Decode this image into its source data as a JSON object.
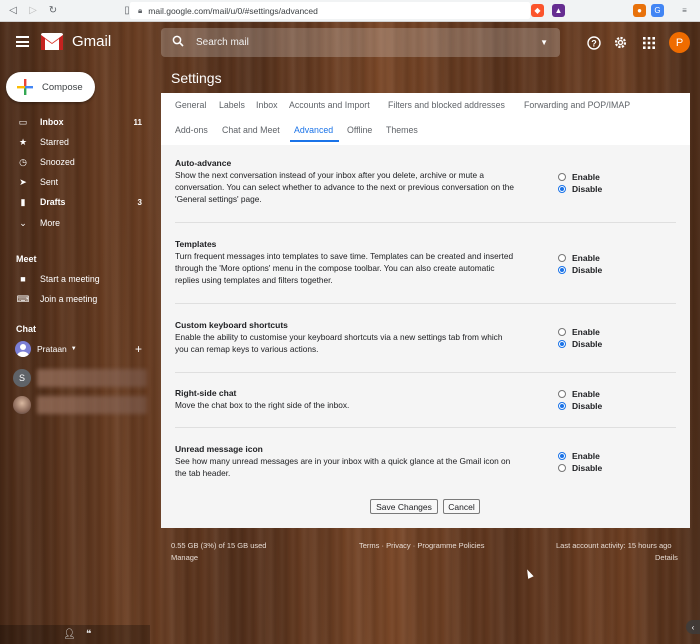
{
  "browser": {
    "url": "mail.google.com/mail/u/0/#settings/advanced"
  },
  "header": {
    "app_name": "Gmail",
    "search_placeholder": "Search mail",
    "avatar_letter": "P"
  },
  "sidebar": {
    "compose_label": "Compose",
    "items": [
      {
        "label": "Inbox",
        "count": "11",
        "icon": "inbox-icon"
      },
      {
        "label": "Starred",
        "count": "",
        "icon": "star-icon"
      },
      {
        "label": "Snoozed",
        "count": "",
        "icon": "clock-icon"
      },
      {
        "label": "Sent",
        "count": "",
        "icon": "send-icon"
      },
      {
        "label": "Drafts",
        "count": "3",
        "icon": "draft-icon"
      },
      {
        "label": "More",
        "count": "",
        "icon": "chevron-down-icon"
      }
    ],
    "meet": {
      "heading": "Meet",
      "items": [
        {
          "label": "Start a meeting",
          "icon": "video-icon"
        },
        {
          "label": "Join a meeting",
          "icon": "keyboard-icon"
        }
      ]
    },
    "chat": {
      "heading": "Chat",
      "user": "Prataan",
      "contact_initial": "S"
    }
  },
  "settings": {
    "title": "Settings",
    "tabs_row1": [
      "General",
      "Labels",
      "Inbox",
      "Accounts and Import",
      "Filters and blocked addresses",
      "Forwarding and POP/IMAP"
    ],
    "tabs_row2": [
      "Add-ons",
      "Chat and Meet",
      "Advanced",
      "Offline",
      "Themes"
    ],
    "active_tab": "Advanced",
    "items": [
      {
        "title": "Auto-advance",
        "desc": "Show the next conversation instead of your inbox after you delete, archive or mute a conversation. You can select whether to advance to the next or previous conversation on the 'General settings' page.",
        "enable_label": "Enable",
        "disable_label": "Disable",
        "selected": "Disable"
      },
      {
        "title": "Templates",
        "desc": "Turn frequent messages into templates to save time. Templates can be created and inserted through the 'More options' menu in the compose toolbar. You can also create automatic replies using templates and filters together.",
        "enable_label": "Enable",
        "disable_label": "Disable",
        "selected": "Disable"
      },
      {
        "title": "Custom keyboard shortcuts",
        "desc": "Enable the ability to customise your keyboard shortcuts via a new settings tab from which you can remap keys to various actions.",
        "enable_label": "Enable",
        "disable_label": "Disable",
        "selected": "Disable"
      },
      {
        "title": "Right-side chat",
        "desc": "Move the chat box to the right side of the inbox.",
        "enable_label": "Enable",
        "disable_label": "Disable",
        "selected": "Disable"
      },
      {
        "title": "Unread message icon",
        "desc": "See how many unread messages are in your inbox with a quick glance at the Gmail icon on the tab header.",
        "enable_label": "Enable",
        "disable_label": "Disable",
        "selected": "Enable"
      }
    ],
    "save_label": "Save Changes",
    "cancel_label": "Cancel"
  },
  "footer": {
    "storage": "0.55 GB (3%) of 15 GB used",
    "manage": "Manage",
    "links": "Terms · Privacy · Programme Policies",
    "activity": "Last account activity: 15 hours ago",
    "details": "Details"
  }
}
